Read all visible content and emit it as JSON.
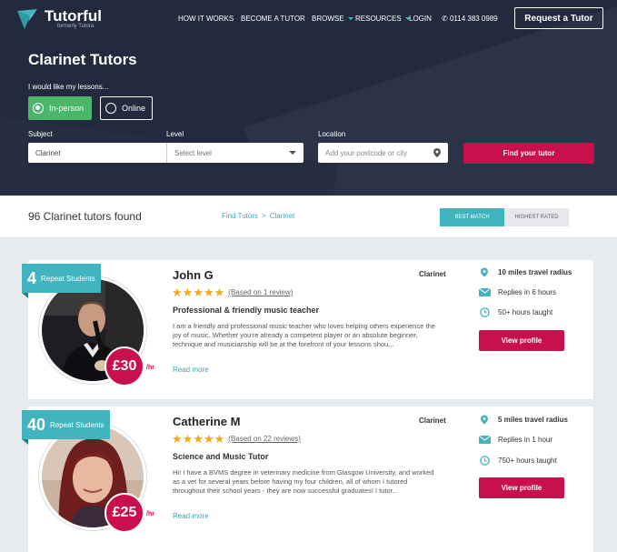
{
  "brand": {
    "name": "Tutorful",
    "subtitle": "formerly Tutora"
  },
  "nav": {
    "how_it_works": "HOW IT WORKS",
    "become_tutor": "BECOME A TUTOR",
    "browse": "BROWSE",
    "resources": "RESOURCES",
    "login": "LOGIN",
    "phone": "0114 383 0989",
    "request_tutor": "Request a Tutor"
  },
  "hero": {
    "title": "Clarinet Tutors",
    "lesson_prompt": "I would like my lessons...",
    "options": [
      {
        "label": "In-person",
        "selected": true
      },
      {
        "label": "Online",
        "selected": false
      }
    ],
    "subject_label": "Subject",
    "subject_value": "Clarinet",
    "level_label": "Level",
    "level_placeholder": "Select level",
    "location_label": "Location",
    "location_placeholder": "Add your postcode or city",
    "find_button": "Find your tutor"
  },
  "results": {
    "count_text": "96 Clarinet tutors found",
    "breadcrumb": [
      "Find Tutors",
      "Clarinet"
    ],
    "sort_best": "BEST MATCH",
    "sort_highest": "HIGHEST RATED"
  },
  "tutors": [
    {
      "repeat_count": "4",
      "repeat_label": "Repeat Students",
      "name": "John G",
      "subject": "Clarinet",
      "rating": 5,
      "reviews": "(Based on 1 review)",
      "headline": "Professional & friendly music teacher",
      "bio": "I am a friendly and professional music teacher who loves helping others experience the joy of music. Whether you're already a competent player or an absolute beginner, technique and musicianship will be at the forefront of your lessons shou...",
      "read_more": "Read more",
      "price": "£30",
      "per": "/hr",
      "travel": "10 miles travel radius",
      "replies": "Replies in 6 hours",
      "hours": "50+ hours taught",
      "view": "View profile"
    },
    {
      "repeat_count": "40",
      "repeat_label": "Repeat Students",
      "name": "Catherine M",
      "subject": "Clarinet",
      "rating": 5,
      "reviews": "(Based on 22 reviews)",
      "headline": "Science and Music Tutor",
      "bio": "Hi! I have a BVMS degree in veterinary medicine from Glasgow University, and worked as a vet for several years before having my four children, all of whom I tutored throughout their school years - they are now successful graduates! I tutor...",
      "read_more": "Read more",
      "price": "£25",
      "per": "/hr",
      "travel": "5 miles travel radius",
      "replies": "Replies in 1 hour",
      "hours": "750+ hours taught",
      "view": "View profile"
    }
  ],
  "colors": {
    "accent": "#c8104d",
    "teal": "#41b4bd",
    "hero": "#232a3d",
    "green": "#4bb56a"
  }
}
